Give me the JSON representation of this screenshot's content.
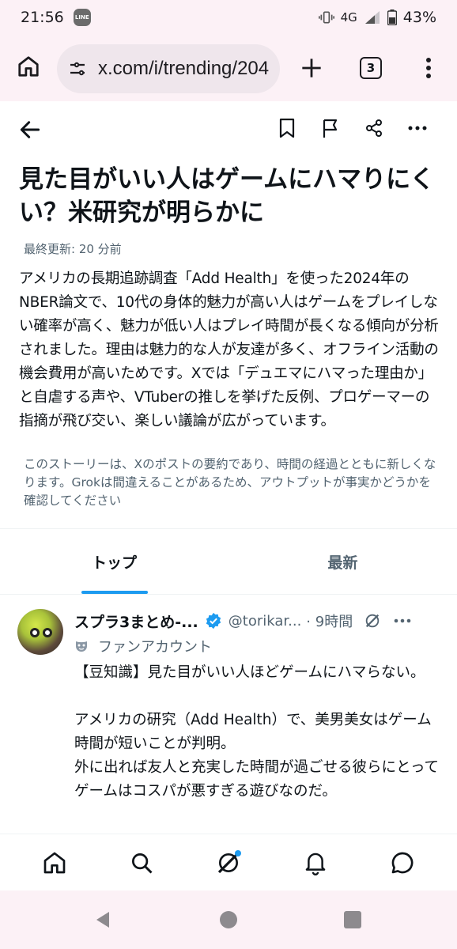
{
  "status_bar": {
    "time": "21:56",
    "line_badge": "LINE",
    "network": "4G",
    "battery": "43%"
  },
  "browser": {
    "url": "x.com/i/trending/204",
    "tab_count": "3"
  },
  "article": {
    "title": "見た目がいい人はゲームにハマりにくい？米研究が明らかに",
    "updated": "最終更新: 20 分前",
    "summary": "アメリカの長期追跡調査「Add Health」を使った2024年のNBER論文で、10代の身体的魅力が高い人はゲームをプレイしない確率が高く、魅力が低い人はプレイ時間が長くなる傾向が分析されました。理由は魅力的な人が友達が多く、オフライン活動の機会費用が高いためです。Xでは「デュエマにハマった理由か」と自虐する声や、VTuberの推しを挙げた反例、プロゲーマーの指摘が飛び交い、楽しい議論が広がっています。",
    "disclaimer": "このストーリーは、Xのポストの要約であり、時間の経過とともに新しくなります。Grokは間違えることがあるため、アウトプットが事実かどうかを確認してください"
  },
  "tabs": [
    {
      "label": "トップ",
      "active": true
    },
    {
      "label": "最新",
      "active": false
    }
  ],
  "post": {
    "author": "スプラ3まとめ-...",
    "handle": "@torikar...",
    "time": "· 9時間",
    "account_type": "ファンアカウント",
    "body": "【豆知識】見た目がいい人ほどゲームにハマらない。\n\nアメリカの研究（Add Health）で、美男美女はゲーム時間が短いことが判明。\n外に出れば友人と充実した時間が過ごせる彼らにとってゲームはコスパが悪すぎる遊びなのだ。"
  },
  "icons": {
    "home": "home-icon",
    "tune": "tune-icon",
    "plus": "plus-icon",
    "more": "more-vert-icon",
    "back": "arrow-left-icon",
    "bookmark": "bookmark-icon",
    "flag": "flag-icon",
    "share": "share-icon",
    "search": "search-icon",
    "grok": "grok-icon",
    "bell": "bell-icon",
    "messages": "chat-bubble-icon"
  },
  "colors": {
    "accent": "#1d9bf0",
    "text": "#0f1419",
    "secondary_text": "#536471",
    "chrome_bg": "#fcf1f6"
  }
}
